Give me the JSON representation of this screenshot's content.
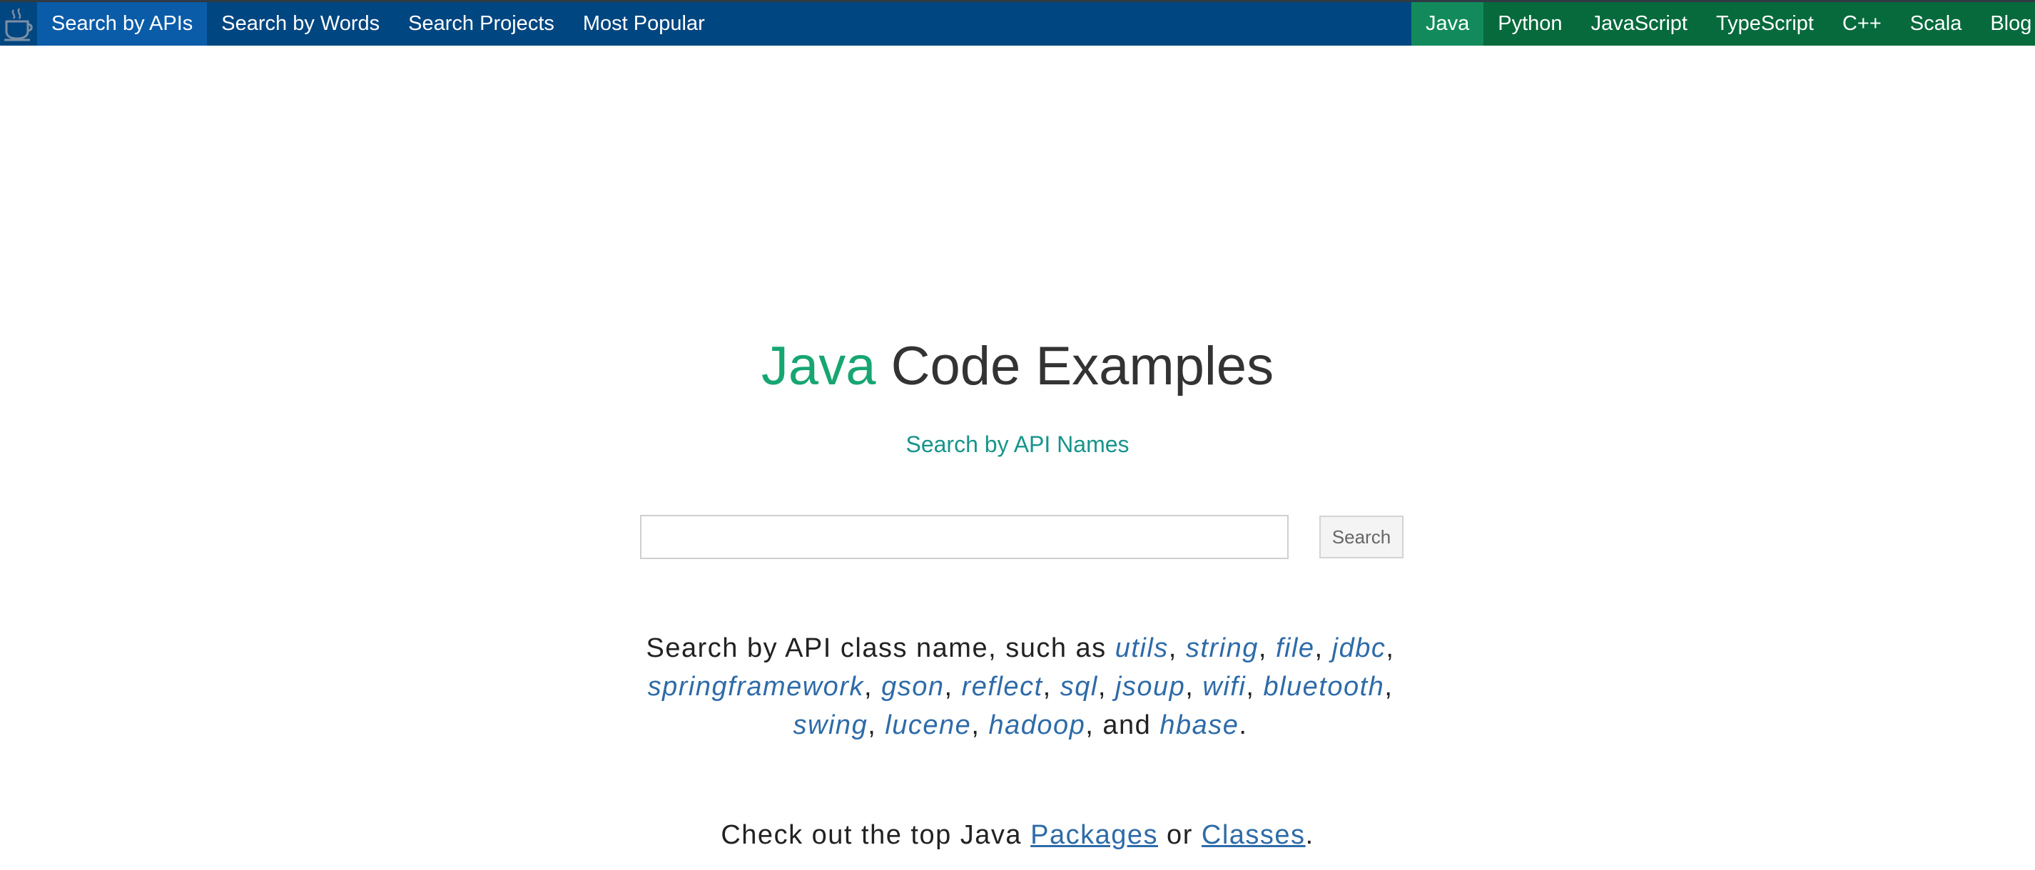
{
  "nav": {
    "left_items": [
      {
        "label": "Search by APIs",
        "active": true
      },
      {
        "label": "Search by Words",
        "active": false
      },
      {
        "label": "Search Projects",
        "active": false
      },
      {
        "label": "Most Popular",
        "active": false
      }
    ],
    "languages": [
      {
        "label": "Java",
        "active": true
      },
      {
        "label": "Python",
        "active": false
      },
      {
        "label": "JavaScript",
        "active": false
      },
      {
        "label": "TypeScript",
        "active": false
      },
      {
        "label": "C++",
        "active": false
      },
      {
        "label": "Scala",
        "active": false
      },
      {
        "label": "Blog",
        "active": false
      }
    ]
  },
  "hero": {
    "title_accent": "Java",
    "title_rest": " Code Examples",
    "subtitle": "Search by API Names"
  },
  "search": {
    "value": "",
    "button_label": "Search"
  },
  "description": {
    "prefix": "Search by API class name, such as ",
    "keywords": [
      "utils",
      "string",
      "file",
      "jdbc",
      "springframework",
      "gson",
      "reflect",
      "sql",
      "jsoup",
      "wifi",
      "bluetooth",
      "swing",
      "lucene",
      "hadoop",
      "hbase"
    ],
    "and_text": "and",
    "suffix": "."
  },
  "bottom": {
    "prefix": "Check out the top Java ",
    "packages_link": "Packages",
    "middle": " or ",
    "classes_link": "Classes",
    "suffix": "."
  },
  "colors": {
    "nav_blue": "#004680",
    "nav_active_blue": "#0b5ca8",
    "nav_green": "#066a3d",
    "nav_active_green": "#128a5c",
    "accent_green": "#17a672",
    "link_blue": "#2e6ba8"
  }
}
